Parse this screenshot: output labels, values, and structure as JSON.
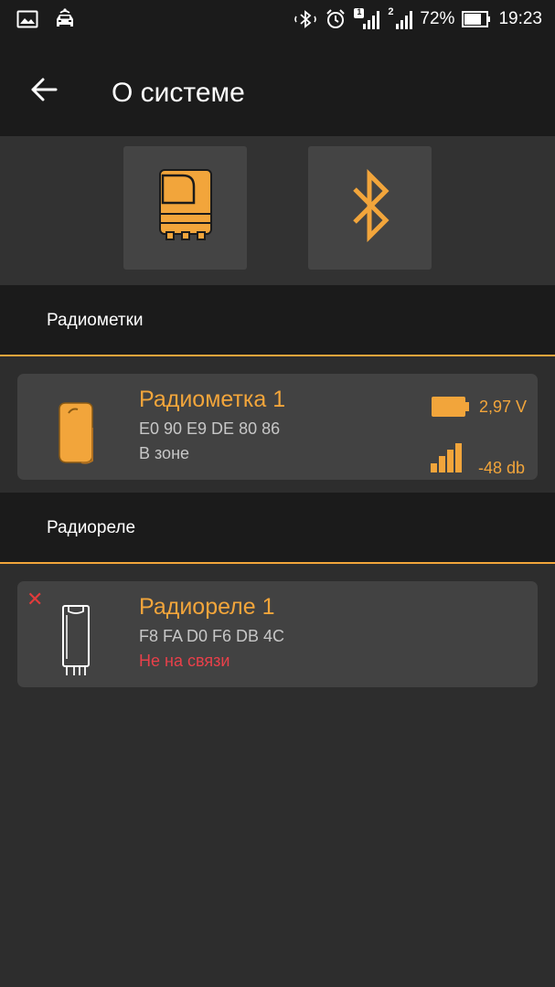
{
  "statusbar": {
    "battery_percent": "72%",
    "time": "19:23",
    "sim1_label": "1",
    "sim2_label": "2"
  },
  "appbar": {
    "title": "О системе"
  },
  "sections": {
    "tags": "Радиометки",
    "relays": "Радиореле"
  },
  "tag": {
    "name": "Радиометка 1",
    "mac": "E0 90 E9 DE 80 86",
    "state": "В зоне",
    "voltage": "2,97 V",
    "signal": "-48 db"
  },
  "relay": {
    "name": "Радиореле 1",
    "mac": "F8 FA D0 F6 DB 4C",
    "state": "Не на связи"
  },
  "colors": {
    "accent": "#f2a53b",
    "error": "#e8404a",
    "background": "#2d2d2d",
    "bar": "#1b1b1b",
    "card": "#424242"
  }
}
